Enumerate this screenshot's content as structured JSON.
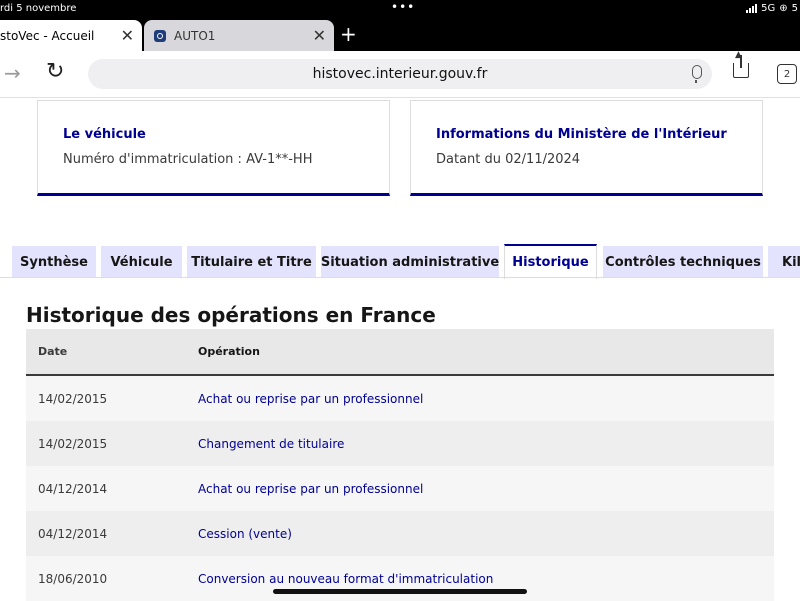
{
  "status_bar": {
    "date": "rdi 5 novembre",
    "network": "5G",
    "battery_glyph": "5"
  },
  "browser": {
    "tabs": [
      {
        "title": "stoVec - Accueil",
        "active": true
      },
      {
        "title": "AUTO1",
        "active": false
      }
    ],
    "url": "histovec.interieur.gouv.fr",
    "tab_count": "2"
  },
  "cards": [
    {
      "title": "Le véhicule",
      "text": "Numéro d'immatriculation : AV-1**-HH"
    },
    {
      "title": "Informations du Ministère de l'Intérieur",
      "text": "Datant du 02/11/2024"
    }
  ],
  "page_tabs": [
    {
      "label": "Synthèse",
      "active": false
    },
    {
      "label": "Véhicule",
      "active": false
    },
    {
      "label": "Titulaire et Titre",
      "active": false
    },
    {
      "label": "Situation administrative",
      "active": false
    },
    {
      "label": "Historique",
      "active": true
    },
    {
      "label": "Contrôles techniques",
      "active": false
    },
    {
      "label": "Kilo",
      "active": false
    }
  ],
  "history": {
    "title": "Historique des opérations en France",
    "columns": [
      "Date",
      "Opération"
    ],
    "rows": [
      {
        "date": "14/02/2015",
        "operation": "Achat ou reprise par un professionnel"
      },
      {
        "date": "14/02/2015",
        "operation": "Changement de titulaire"
      },
      {
        "date": "04/12/2014",
        "operation": "Achat ou reprise par un professionnel"
      },
      {
        "date": "04/12/2014",
        "operation": "Cession (vente)"
      },
      {
        "date": "18/06/2010",
        "operation": "Conversion au nouveau format d'immatriculation"
      }
    ]
  },
  "colors": {
    "accent": "#000091",
    "tab_background": "#e3e3fd"
  }
}
